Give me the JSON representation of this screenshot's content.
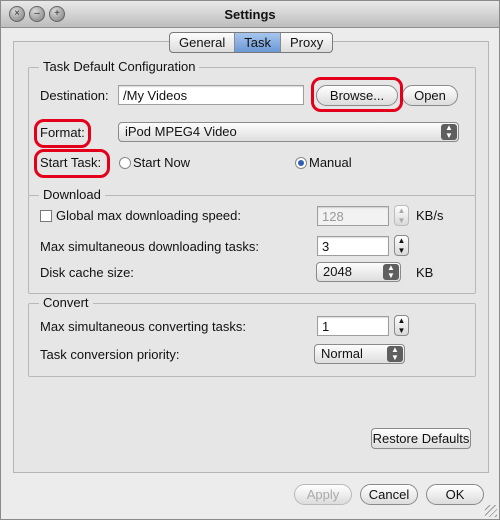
{
  "window": {
    "title": "Settings"
  },
  "tabs": [
    {
      "label": "General",
      "active": false
    },
    {
      "label": "Task",
      "active": true
    },
    {
      "label": "Proxy",
      "active": false
    }
  ],
  "task_default": {
    "group_label": "Task Default Configuration",
    "destination_label": "Destination:",
    "destination_value": "/My Videos",
    "browse_label": "Browse...",
    "open_label": "Open",
    "format_label": "Format:",
    "format_value": "iPod MPEG4 Video",
    "start_task_label": "Start Task:",
    "start_now_label": "Start Now",
    "manual_label": "Manual",
    "start_task_selected": "Manual"
  },
  "download": {
    "group_label": "Download",
    "global_speed_label": "Global max downloading speed:",
    "global_speed_checked": false,
    "global_speed_value": "128",
    "global_speed_unit": "KB/s",
    "max_tasks_label": "Max simultaneous downloading tasks:",
    "max_tasks_value": "3",
    "disk_cache_label": "Disk cache size:",
    "disk_cache_value": "2048",
    "disk_cache_unit": "KB"
  },
  "convert": {
    "group_label": "Convert",
    "max_tasks_label": "Max simultaneous converting tasks:",
    "max_tasks_value": "1",
    "priority_label": "Task conversion priority:",
    "priority_value": "Normal"
  },
  "buttons": {
    "restore": "Restore Defaults",
    "apply": "Apply",
    "cancel": "Cancel",
    "ok": "OK"
  },
  "colors": {
    "highlight": "#e4001b",
    "selected_tab": "#7aa3dc"
  }
}
